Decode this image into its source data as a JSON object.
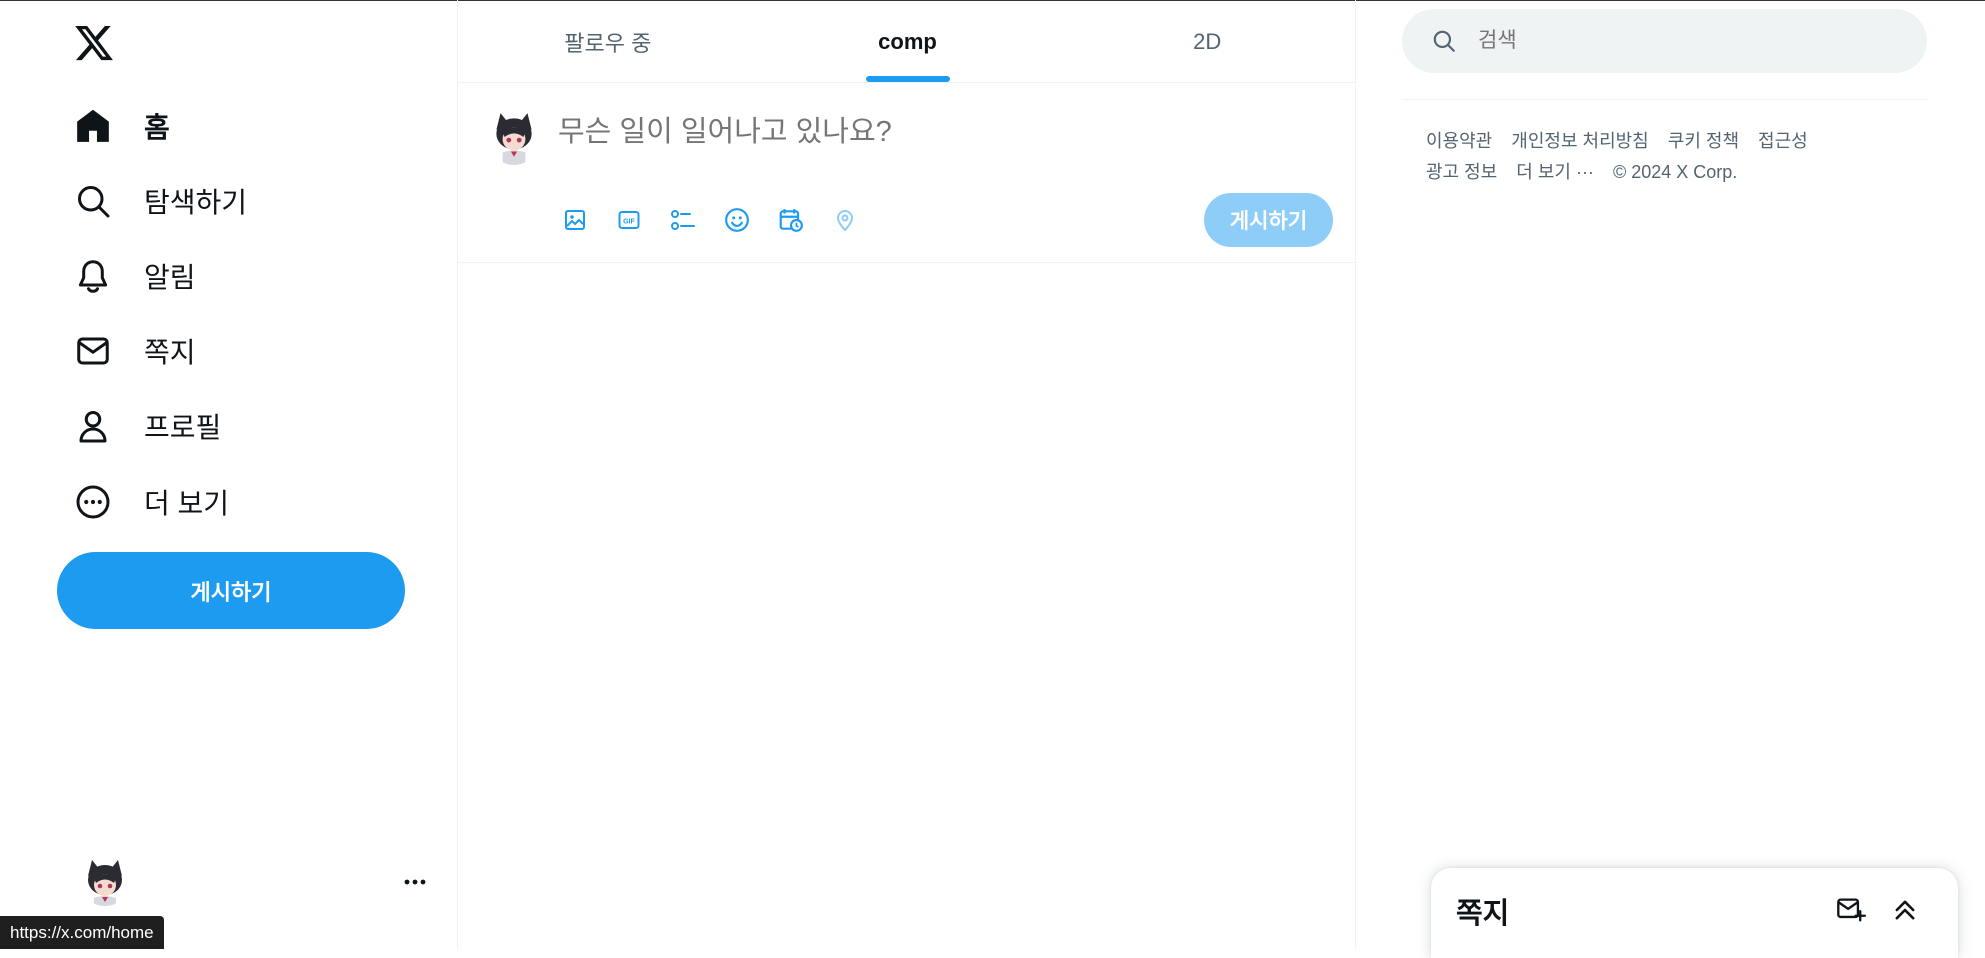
{
  "nav": {
    "items": [
      {
        "label": "홈",
        "icon": "home-icon"
      },
      {
        "label": "탐색하기",
        "icon": "search-icon"
      },
      {
        "label": "알림",
        "icon": "bell-icon"
      },
      {
        "label": "쪽지",
        "icon": "mail-icon"
      },
      {
        "label": "프로필",
        "icon": "person-icon"
      },
      {
        "label": "더 보기",
        "icon": "more-circle-icon"
      }
    ],
    "post_button": "게시하기"
  },
  "status_url": "https://x.com/home",
  "timeline": {
    "tabs": [
      {
        "label": "팔로우 중",
        "active": false
      },
      {
        "label": "comp",
        "active": true
      },
      {
        "label": "2D",
        "active": false
      }
    ]
  },
  "composer": {
    "placeholder": "무슨 일이 일어나고 있나요?",
    "tools": [
      "image-icon",
      "gif-icon",
      "poll-icon",
      "emoji-icon",
      "schedule-icon",
      "location-icon"
    ],
    "post_button": "게시하기"
  },
  "search": {
    "placeholder": "검색"
  },
  "footer": {
    "links": [
      "이용약관",
      "개인정보 처리방침",
      "쿠키 정책",
      "접근성",
      "광고 정보",
      "더 보기 ···"
    ],
    "copyright": "© 2024 X Corp."
  },
  "dm_drawer": {
    "title": "쪽지"
  },
  "colors": {
    "accent": "#1d9bf0",
    "accent_disabled": "#8ecdf8",
    "text": "#0f1419",
    "muted": "#536471"
  }
}
